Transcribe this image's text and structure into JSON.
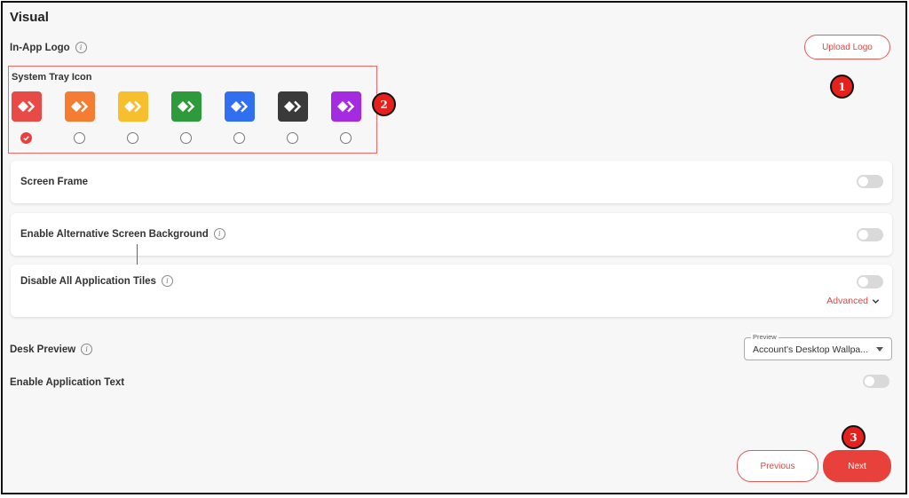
{
  "page_title": "Visual",
  "in_app_logo": {
    "label": "In-App Logo",
    "upload_button": "Upload Logo"
  },
  "system_tray": {
    "label": "System Tray Icon",
    "icons": [
      {
        "color": "#e84a45",
        "selected": true
      },
      {
        "color": "#f47c33",
        "selected": false
      },
      {
        "color": "#f7bf2d",
        "selected": false
      },
      {
        "color": "#2d9a3b",
        "selected": false
      },
      {
        "color": "#2f6ff0",
        "selected": false
      },
      {
        "color": "#3a3a3a",
        "selected": false
      },
      {
        "color": "#a52be0",
        "selected": false
      }
    ]
  },
  "settings": {
    "screen_frame": "Screen Frame",
    "alt_background": "Enable Alternative Screen Background",
    "disable_tiles": "Disable All Application Tiles",
    "advanced": "Advanced"
  },
  "desk_preview": {
    "label": "Desk Preview",
    "select_legend": "Preview",
    "select_value": "Account's Desktop Wallpa..."
  },
  "app_text": {
    "label": "Enable Application Text"
  },
  "footer": {
    "previous": "Previous",
    "next": "Next"
  },
  "callouts": {
    "one": "1",
    "two": "2",
    "three": "3"
  },
  "colors": {
    "accent": "#e8403b",
    "callout": "#e6201c"
  }
}
